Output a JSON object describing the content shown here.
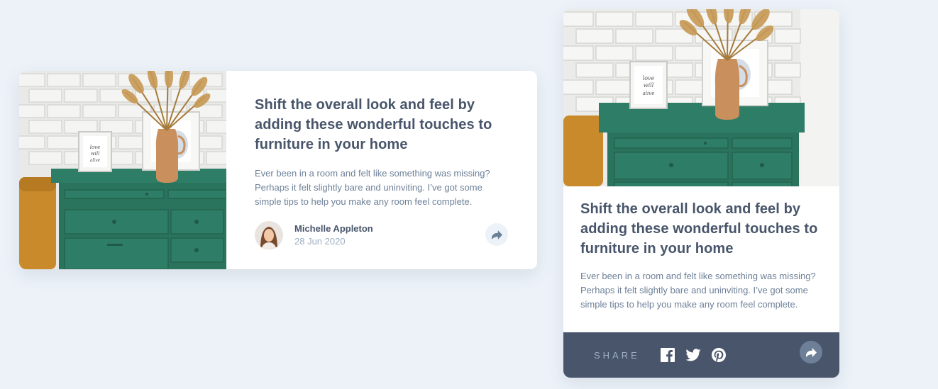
{
  "article": {
    "title": "Shift the overall look and feel by adding these wonderful touches to furniture in your home",
    "excerpt": "Ever been in a room and felt like something was missing? Perhaps it felt slightly bare and uninviting. I’ve got some simple tips to help you make any room feel complete.",
    "author_name": "Michelle Appleton",
    "date": "28 Jun 2020",
    "frame_text": "love will be us alive"
  },
  "share_bar": {
    "label": "SHARE",
    "icons": [
      "facebook-icon",
      "twitter-icon",
      "pinterest-icon"
    ]
  },
  "icons": {
    "share": "share-arrow-icon"
  },
  "colors": {
    "background": "#ecf2f8",
    "title": "#48556a",
    "text": "#6e8098",
    "muted": "#9eafc2",
    "share_bar": "#48556a",
    "dresser_green": "#2e7d66"
  }
}
